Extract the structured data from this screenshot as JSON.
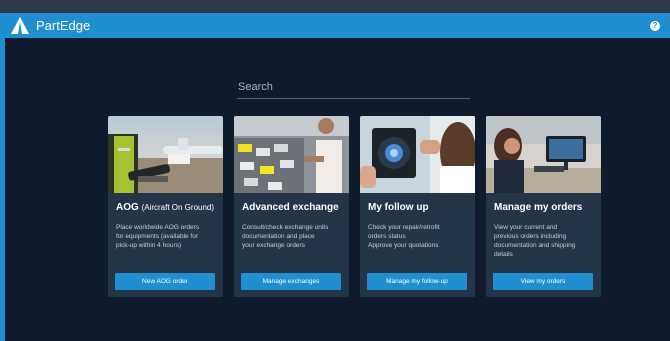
{
  "header": {
    "brand": "PartEdge",
    "help_label": "?"
  },
  "search": {
    "placeholder": "Search"
  },
  "cards": [
    {
      "title": "AOG",
      "subtitle": "(Aircraft On Ground)",
      "description": [
        "Place worldwide AOG orders",
        "for equipments (available for",
        "pick-up within 4 hours)"
      ],
      "button": "New AOG order"
    },
    {
      "title": "Advanced exchange",
      "subtitle": "",
      "description": [
        "Consult/check exchange units",
        "documentation and place",
        "your exchange orders"
      ],
      "button": "Manage exchanges"
    },
    {
      "title": "My follow up",
      "subtitle": "",
      "description": [
        "Check your repair/retrofit",
        "orders status",
        "Approve your quotations"
      ],
      "button": "Manage my follow-up"
    },
    {
      "title": "Manage my orders",
      "subtitle": "",
      "description": [
        "View your current and",
        "previous orders including",
        "documentation and shipping",
        "details"
      ],
      "button": "View my orders"
    }
  ],
  "colors": {
    "accent": "#1f8fd1",
    "background": "#0f1b2d",
    "card": "#253548"
  }
}
